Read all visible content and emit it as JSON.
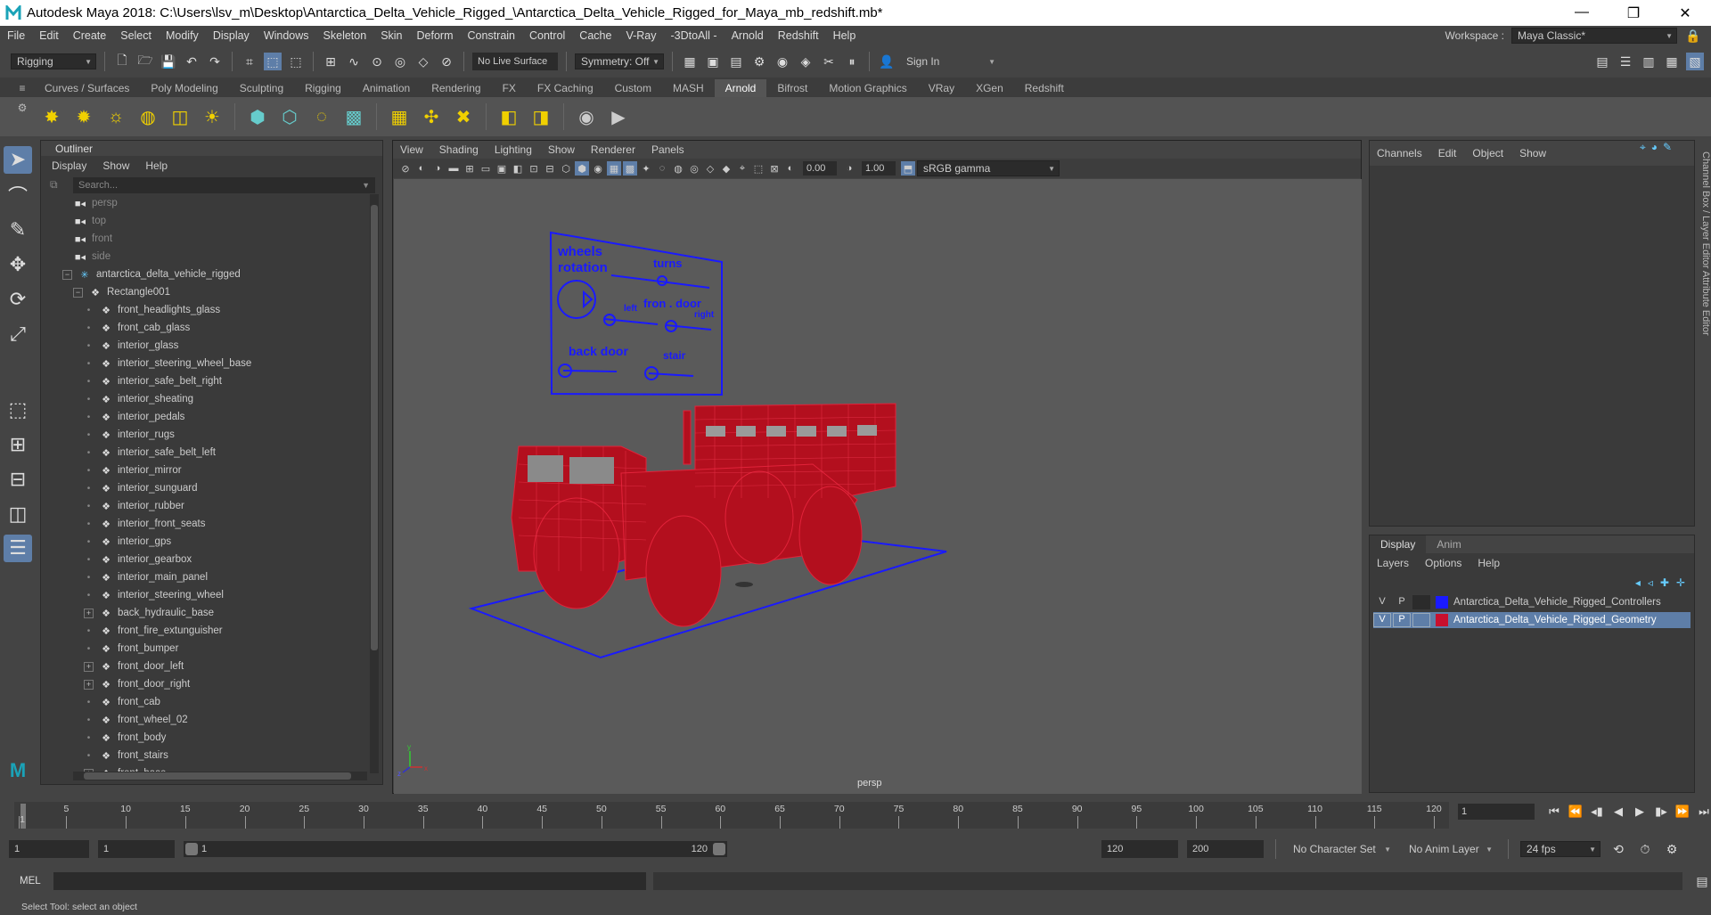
{
  "window": {
    "title": "Autodesk Maya 2018: C:\\Users\\lsv_m\\Desktop\\Antarctica_Delta_Vehicle_Rigged_\\Antarctica_Delta_Vehicle_Rigged_for_Maya_mb_redshift.mb*"
  },
  "menubar": {
    "items": [
      "File",
      "Edit",
      "Create",
      "Select",
      "Modify",
      "Display",
      "Windows",
      "Skeleton",
      "Skin",
      "Deform",
      "Constrain",
      "Control",
      "Cache",
      "V-Ray",
      "-3DtoAll -",
      "Arnold",
      "Redshift",
      "Help"
    ],
    "workspace_label": "Workspace :",
    "workspace_value": "Maya Classic*"
  },
  "statusline": {
    "mode": "Rigging",
    "live_surface": "No Live Surface",
    "symmetry": "Symmetry: Off",
    "sign_in": "Sign In"
  },
  "shelf": {
    "tabs": [
      "Curves / Surfaces",
      "Poly Modeling",
      "Sculpting",
      "Rigging",
      "Animation",
      "Rendering",
      "FX",
      "FX Caching",
      "Custom",
      "MASH",
      "Arnold",
      "Bifrost",
      "Motion Graphics",
      "VRay",
      "XGen",
      "Redshift"
    ],
    "active_tab": "Arnold"
  },
  "outliner": {
    "title": "Outliner",
    "menu": [
      "Display",
      "Show",
      "Help"
    ],
    "search_placeholder": "Search...",
    "cameras": [
      "persp",
      "top",
      "front",
      "side"
    ],
    "root": "antarctica_delta_vehicle_rigged",
    "group": "Rectangle001",
    "items": [
      {
        "name": "front_headlights_glass",
        "expandable": false
      },
      {
        "name": "front_cab_glass",
        "expandable": false
      },
      {
        "name": "interior_glass",
        "expandable": false
      },
      {
        "name": "interior_steering_wheel_base",
        "expandable": false
      },
      {
        "name": "interior_safe_belt_right",
        "expandable": false
      },
      {
        "name": "interior_sheating",
        "expandable": false
      },
      {
        "name": "interior_pedals",
        "expandable": false
      },
      {
        "name": "interior_rugs",
        "expandable": false
      },
      {
        "name": "interior_safe_belt_left",
        "expandable": false
      },
      {
        "name": "interior_mirror",
        "expandable": false
      },
      {
        "name": "interior_sunguard",
        "expandable": false
      },
      {
        "name": "interior_rubber",
        "expandable": false
      },
      {
        "name": "interior_front_seats",
        "expandable": false
      },
      {
        "name": "interior_gps",
        "expandable": false
      },
      {
        "name": "interior_gearbox",
        "expandable": false
      },
      {
        "name": "interior_main_panel",
        "expandable": false
      },
      {
        "name": "interior_steering_wheel",
        "expandable": false
      },
      {
        "name": "back_hydraulic_base",
        "expandable": true
      },
      {
        "name": "front_fire_extunguisher",
        "expandable": false
      },
      {
        "name": "front_bumper",
        "expandable": false
      },
      {
        "name": "front_door_left",
        "expandable": true
      },
      {
        "name": "front_door_right",
        "expandable": true
      },
      {
        "name": "front_cab",
        "expandable": false
      },
      {
        "name": "front_wheel_02",
        "expandable": false
      },
      {
        "name": "front_body",
        "expandable": false
      },
      {
        "name": "front_stairs",
        "expandable": false
      },
      {
        "name": "front_base",
        "expandable": true
      }
    ]
  },
  "viewport": {
    "menu": [
      "View",
      "Shading",
      "Lighting",
      "Show",
      "Renderer",
      "Panels"
    ],
    "exposure": "0.00",
    "gamma": "1.00",
    "color_space": "sRGB gamma",
    "camera_label": "persp",
    "controller_labels": {
      "wheels_rotation": "wheels\nrotation",
      "turns": "turns",
      "left": "left",
      "front_door": "fron . door",
      "right": "right",
      "back_door": "back door",
      "stair": "stair"
    }
  },
  "channelbox": {
    "menu": [
      "Channels",
      "Edit",
      "Object",
      "Show"
    ]
  },
  "layereditor": {
    "tabs": [
      "Display",
      "Anim"
    ],
    "active_tab": "Display",
    "menu": [
      "Layers",
      "Options",
      "Help"
    ],
    "layers": [
      {
        "v": "V",
        "p": "P",
        "color": "#1a1aff",
        "name": "Antarctica_Delta_Vehicle_Rigged_Controllers",
        "selected": false
      },
      {
        "v": "V",
        "p": "P",
        "color": "#c8102e",
        "name": "Antarctica_Delta_Vehicle_Rigged_Geometry",
        "selected": true
      }
    ]
  },
  "sidetabs": "Channel Box / Layer Editor    Attribute Editor",
  "timeline": {
    "ticks": [
      1,
      5,
      10,
      15,
      20,
      25,
      30,
      35,
      40,
      45,
      50,
      55,
      60,
      65,
      70,
      75,
      80,
      85,
      90,
      95,
      100,
      105,
      110,
      115,
      120
    ],
    "current_frame": "1"
  },
  "range": {
    "start": "1",
    "start_inner": "1",
    "slider_start": "1",
    "slider_end": "120",
    "end": "120",
    "end_total": "200",
    "character_set": "No Character Set",
    "anim_layer": "No Anim Layer",
    "fps": "24 fps"
  },
  "mel": {
    "label": "MEL"
  },
  "helpline": {
    "text": "Select Tool: select an object"
  },
  "colors": {
    "accent": "#5e7ea8",
    "mesh": "#c8102e",
    "controller": "#1a1aff"
  }
}
